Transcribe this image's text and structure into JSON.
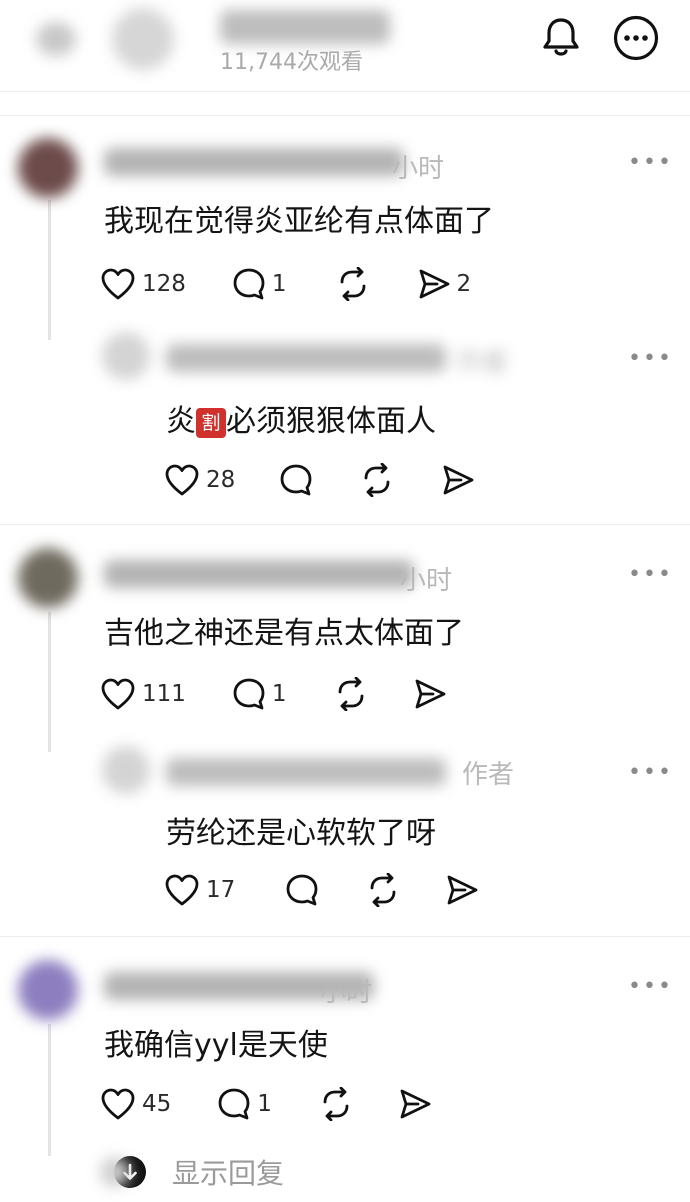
{
  "header": {
    "views_text": "11,744次观看",
    "icons": [
      "back-icon",
      "bell-icon",
      "more-icon"
    ]
  },
  "comments": [
    {
      "time_suffix": "小时",
      "text": "我现在觉得炎亚纶有点体面了",
      "likes": "128",
      "replies": "1",
      "shares": "2",
      "reply": {
        "author_tag": "作者",
        "text_before": "炎",
        "emoji_char": "割",
        "text_after": "必须狠狠体面人",
        "likes": "28"
      }
    },
    {
      "time_suffix": "小时",
      "text": "吉他之神还是有点太体面了",
      "likes": "111",
      "replies": "1",
      "reply": {
        "author_tag": "作者",
        "text": "劳纶还是心软软了呀",
        "likes": "17"
      }
    },
    {
      "time_suffix": "小时",
      "text": "我确信yyl是天使",
      "likes": "45",
      "replies": "1"
    }
  ],
  "show_replies_label": "显示回复",
  "colors": {
    "accent_emoji": "#d0312d",
    "text": "#141414",
    "muted": "#b9b9b9"
  }
}
